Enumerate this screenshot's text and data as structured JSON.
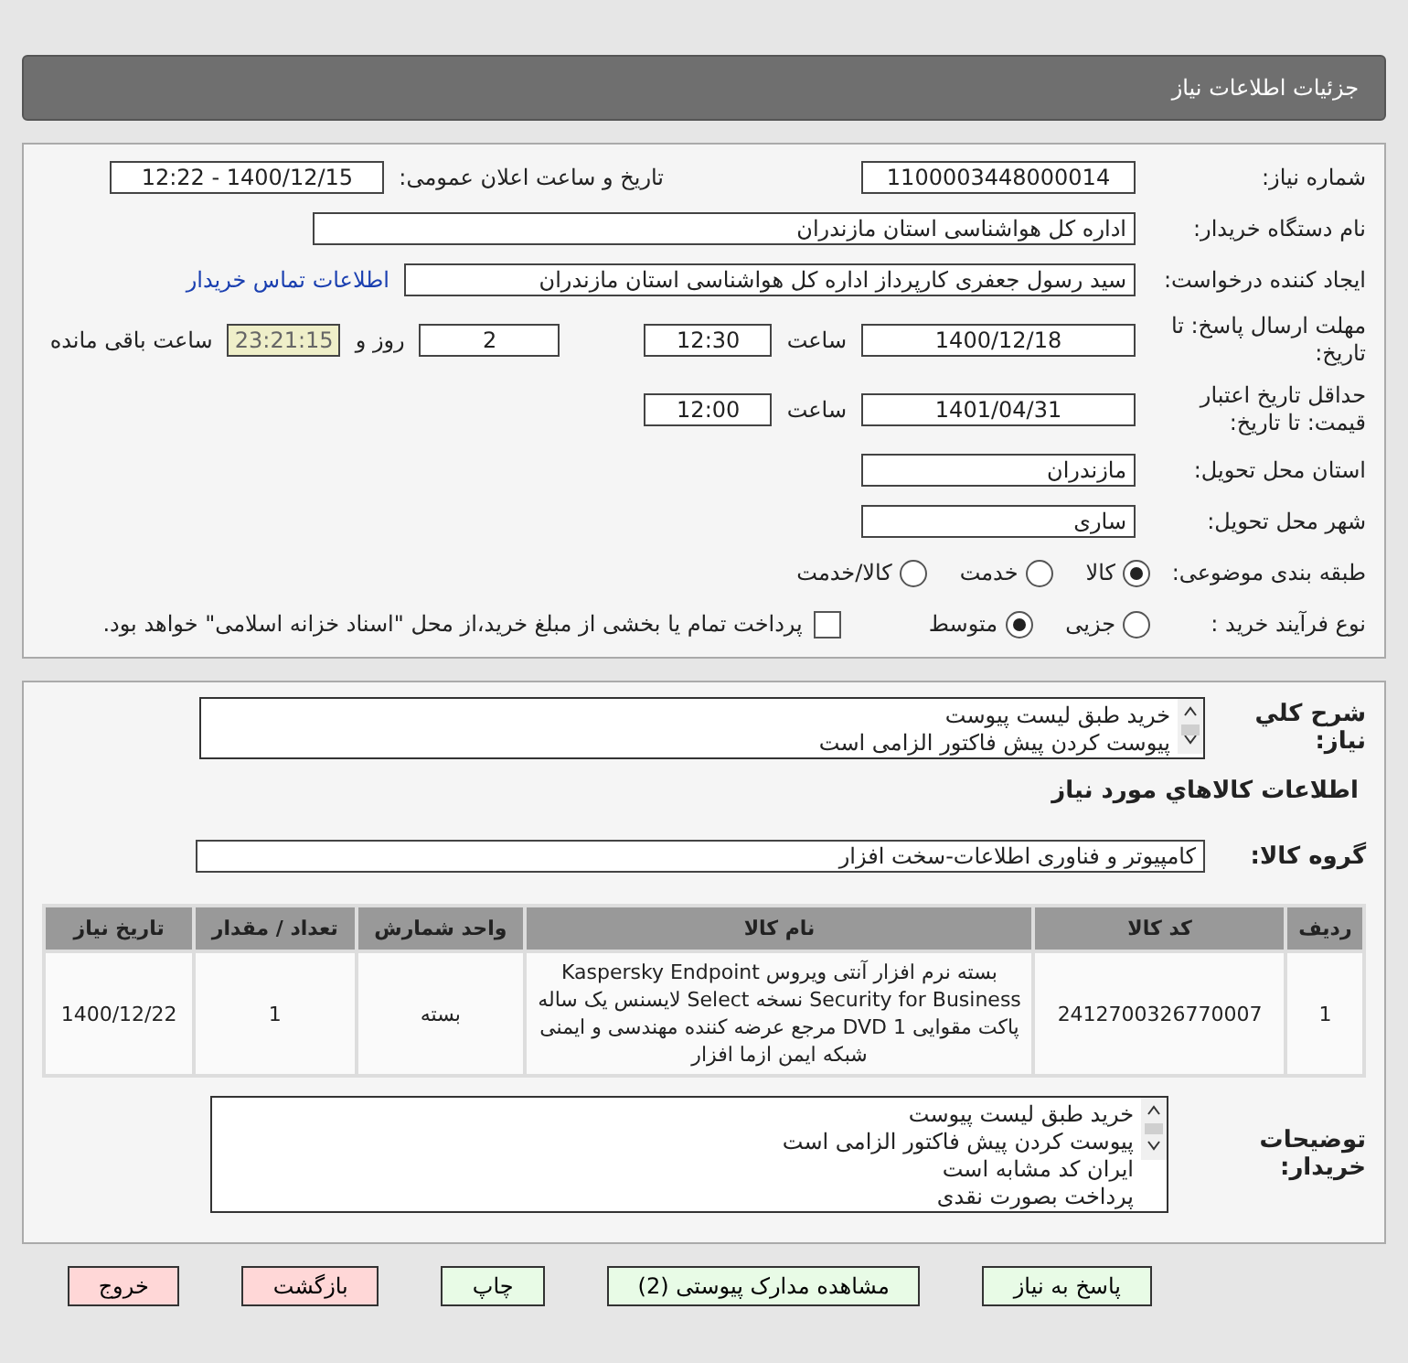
{
  "header": {
    "title": "جزئیات اطلاعات نیاز"
  },
  "need_number": {
    "label": "شماره نیاز:",
    "value": "1100003448000014"
  },
  "announce": {
    "label": "تاریخ و ساعت اعلان عمومی:",
    "value": "1400/12/15 - 12:22"
  },
  "buyer_org": {
    "label": "نام دستگاه خریدار:",
    "value": "اداره کل هواشناسی استان مازندران"
  },
  "requester": {
    "label": "ایجاد کننده درخواست:",
    "value": "سید رسول  جعفری کارپرداز اداره کل هواشناسی استان مازندران",
    "link": "اطلاعات تماس خریدار"
  },
  "reply_deadline": {
    "label": "مهلت ارسال پاسخ: تا تاریخ:",
    "date": "1400/12/18",
    "time_label": "ساعت",
    "time": "12:30",
    "days": "2",
    "days_label": "روز و",
    "remaining": "23:21:15",
    "remaining_label": "ساعت باقی مانده"
  },
  "price_validity": {
    "label": "حداقل تاریخ اعتبار قیمت: تا تاریخ:",
    "date": "1401/04/31",
    "time_label": "ساعت",
    "time": "12:00"
  },
  "province": {
    "label": "استان محل تحویل:",
    "value": "مازندران"
  },
  "city": {
    "label": "شهر محل تحویل:",
    "value": "ساری"
  },
  "category": {
    "label": "طبقه بندی موضوعی:",
    "options": [
      {
        "label": "کالا",
        "selected": true
      },
      {
        "label": "خدمت",
        "selected": false
      },
      {
        "label": "کالا/خدمت",
        "selected": false
      }
    ]
  },
  "process": {
    "label": "نوع فرآیند خرید :",
    "options": [
      {
        "label": "جزیی",
        "selected": false
      },
      {
        "label": "متوسط",
        "selected": true
      }
    ],
    "payment": {
      "label": "پرداخت تمام یا بخشی از مبلغ خرید،از محل \"اسناد خزانه اسلامی\" خواهد بود.",
      "checked": false
    }
  },
  "description": {
    "label": "شرح کلي نياز:",
    "lines": [
      "خرید طبق لیست پیوست",
      "پیوست کردن پیش فاکتور الزامی است"
    ]
  },
  "goods_title": "اطلاعات كالاهاي مورد نياز",
  "goods_group": {
    "label": "گروه کالا:",
    "value": "کامپیوتر و فناوری اطلاعات-سخت افزار"
  },
  "table": {
    "columns": [
      "ردیف",
      "کد کالا",
      "نام کالا",
      "واحد شمارش",
      "تعداد / مقدار",
      "تاریخ نیاز"
    ],
    "rows": [
      [
        "1",
        "2412700326770007",
        "بسته نرم افزار آنتی ویروس Kaspersky Endpoint Security for Business نسخه Select لایسنس یک ساله پاکت مقوایی 1 DVD مرجع عرضه کننده مهندسی و ایمنی شبکه ایمن ازما افزار",
        "بسته",
        "1",
        "1400/12/22"
      ]
    ]
  },
  "buyer_notes": {
    "label": "توضیحات خریدار:",
    "lines": [
      "خرید طبق لیست پیوست",
      "پیوست کردن پیش فاکتور الزامی است",
      "ایران کد مشابه است",
      "پرداخت بصورت نقدی"
    ]
  },
  "buttons": [
    {
      "label": "پاسخ به نیاز",
      "kind": "normal"
    },
    {
      "label": "مشاهده مدارک پیوستی (2)",
      "kind": "normal"
    },
    {
      "label": "چاپ",
      "kind": "normal"
    },
    {
      "label": "بازگشت",
      "kind": "danger"
    },
    {
      "label": "خروج",
      "kind": "danger"
    }
  ]
}
